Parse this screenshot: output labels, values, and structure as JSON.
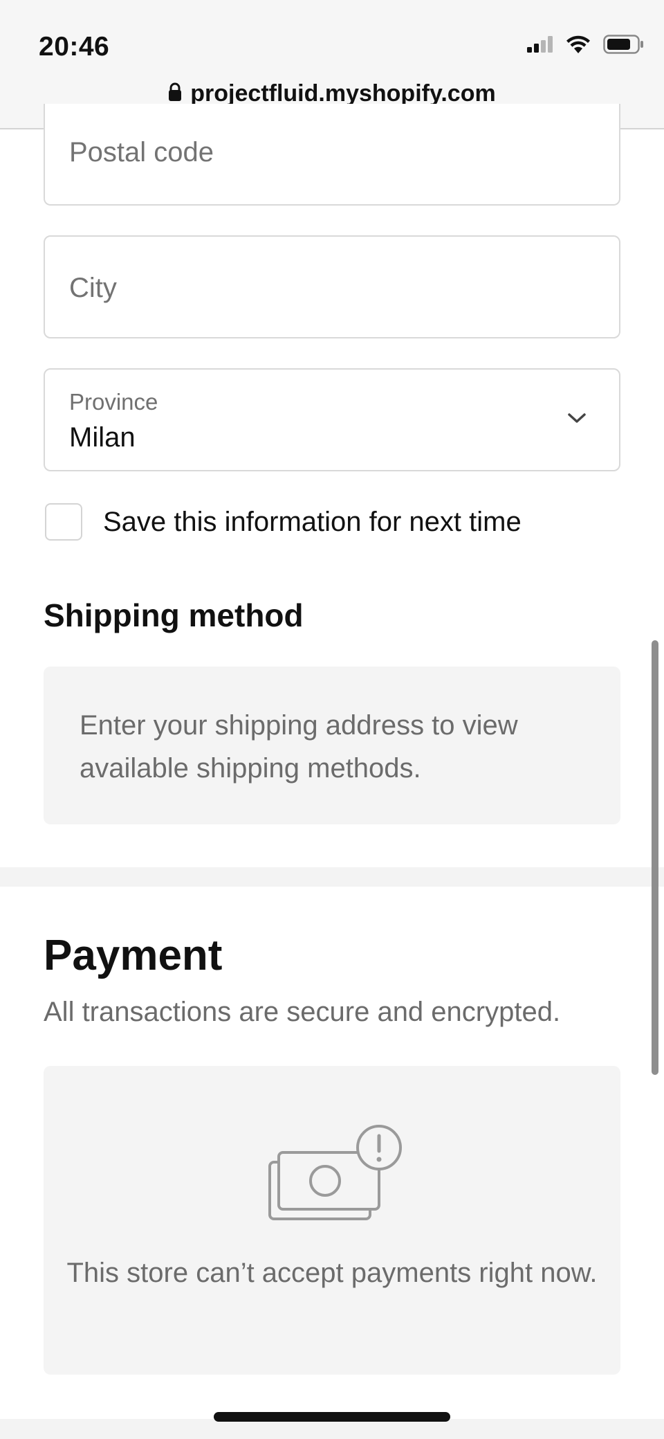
{
  "status_bar": {
    "time": "20:46",
    "icons": [
      "cellular-signal-icon",
      "wifi-icon",
      "battery-icon"
    ]
  },
  "browser": {
    "url": "projectfluid.myshopify.com",
    "lock_icon": "lock-icon"
  },
  "address_form": {
    "postal_code_placeholder": "Postal code",
    "city_placeholder": "City",
    "province_label": "Province",
    "province_value": "Milan",
    "save_info_label": "Save this information for next time",
    "save_info_checked": false
  },
  "shipping": {
    "heading": "Shipping method",
    "notice": "Enter your shipping address to view available shipping methods."
  },
  "payment": {
    "heading": "Payment",
    "subtitle": "All transactions are secure and encrypted.",
    "icon": "cash-warning-icon",
    "message": "This store can’t accept payments right now."
  },
  "colors": {
    "muted_text": "#6b6b6b",
    "field_border": "#d9d9d9",
    "panel_bg": "#f4f4f4"
  }
}
